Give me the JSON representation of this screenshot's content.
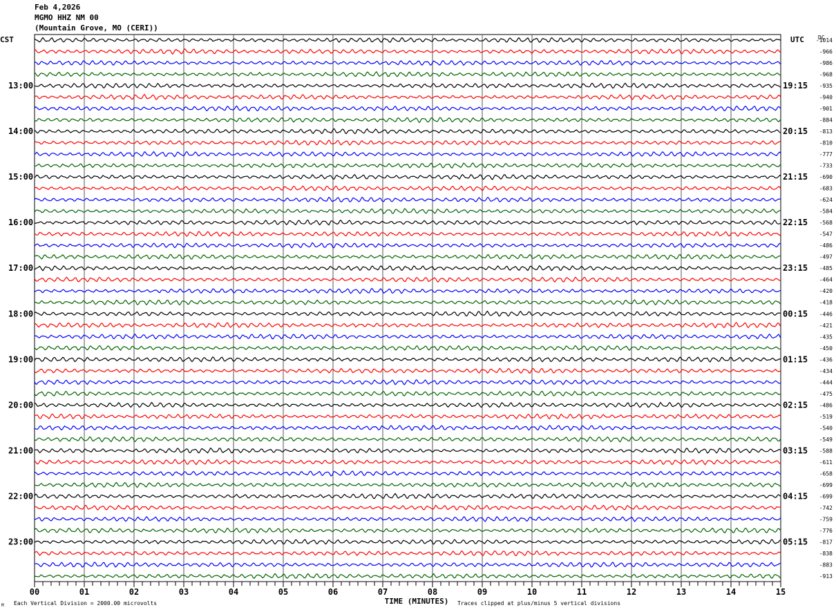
{
  "header": {
    "date": "Feb 4,2026",
    "station": "MGMO HHZ NM 00",
    "location": "(Mountain Grove, MO (CERI))"
  },
  "chart_data": {
    "type": "line",
    "title": "",
    "xlabel": "TIME (MINUTES)",
    "xlim": [
      0,
      15
    ],
    "x_ticks": [
      "00",
      "01",
      "02",
      "03",
      "04",
      "05",
      "06",
      "07",
      "08",
      "09",
      "10",
      "11",
      "12",
      "13",
      "14",
      "15"
    ],
    "left_timezone": "CST",
    "right_timezone": "UTC",
    "dc_label": "DC",
    "left_hour_labels": [
      "13:00",
      "14:00",
      "15:00",
      "16:00",
      "17:00",
      "18:00",
      "19:00",
      "20:00",
      "21:00",
      "22:00",
      "23:00"
    ],
    "right_hour_labels": [
      "19:15",
      "20:15",
      "21:15",
      "22:15",
      "23:15",
      "00:15",
      "01:15",
      "02:15",
      "03:15",
      "04:15",
      "05:15"
    ],
    "trace_colors": [
      "#000000",
      "#ff0000",
      "#0000ff",
      "#006400"
    ],
    "trace_count": 48,
    "dc_offsets": [
      "-1014",
      "-966",
      "-986",
      "-968",
      "-935",
      "-940",
      "-901",
      "-884",
      "-813",
      "-810",
      "-777",
      "-733",
      "-690",
      "-683",
      "-624",
      "-584",
      "-568",
      "-547",
      "-486",
      "-497",
      "-485",
      "-464",
      "-420",
      "-418",
      "-446",
      "-421",
      "-435",
      "-450",
      "-436",
      "-434",
      "-444",
      "-475",
      "-486",
      "-519",
      "-540",
      "-549",
      "-588",
      "-611",
      "-658",
      "-699",
      "-699",
      "-742",
      "-759",
      "-776",
      "-817",
      "-838",
      "-883",
      "-913"
    ],
    "grid": true
  },
  "footer": {
    "scale_note": "Each Vertical Division = 2000.00 microvolts",
    "clip_note": "Traces clipped at plus/minus 5 vertical divisions",
    "corner_mark": "M"
  }
}
